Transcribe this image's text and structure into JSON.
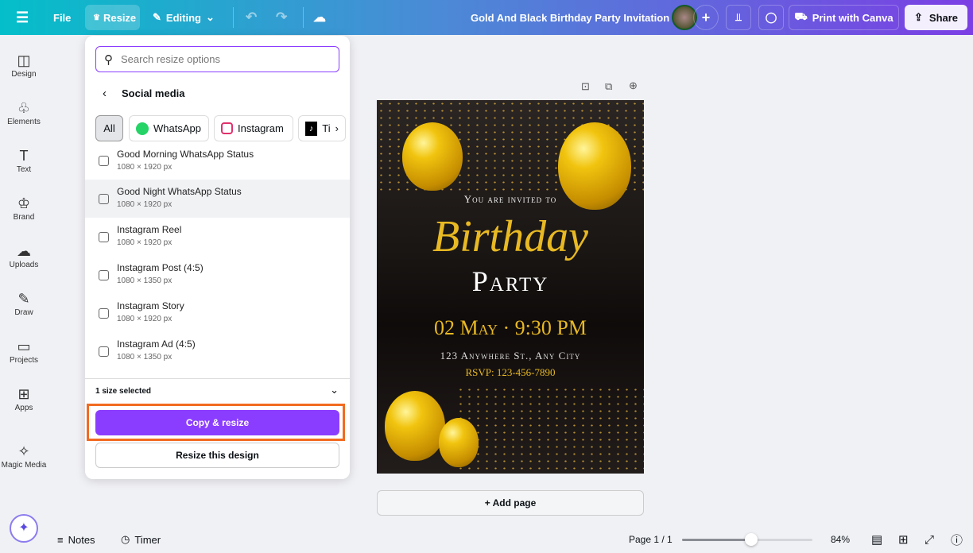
{
  "topbar": {
    "menu_icon": "hamburger-icon",
    "file": "File",
    "resize": "Resize",
    "editing": "Editing",
    "title": "Gold And Black Birthday Party Invitation",
    "print": "Print with Canva",
    "share": "Share"
  },
  "sidebar": {
    "items": [
      {
        "label": "Design",
        "icon": "◫"
      },
      {
        "label": "Elements",
        "icon": "♧"
      },
      {
        "label": "Text",
        "icon": "T"
      },
      {
        "label": "Brand",
        "icon": "♔"
      },
      {
        "label": "Uploads",
        "icon": "☁"
      },
      {
        "label": "Draw",
        "icon": "✎"
      },
      {
        "label": "Projects",
        "icon": "▭"
      },
      {
        "label": "Apps",
        "icon": "⊞"
      },
      {
        "label": "Magic Media",
        "icon": "✧"
      }
    ]
  },
  "resize_panel": {
    "search_placeholder": "Search resize options",
    "section": "Social media",
    "chips": [
      "All",
      "WhatsApp",
      "Instagram",
      "Ti"
    ],
    "items": [
      {
        "name": "Good Morning WhatsApp Status",
        "size": "1080 × 1920 px"
      },
      {
        "name": "Good Night WhatsApp Status",
        "size": "1080 × 1920 px"
      },
      {
        "name": "Instagram Reel",
        "size": "1080 × 1920 px"
      },
      {
        "name": "Instagram Post (4:5)",
        "size": "1080 × 1350 px"
      },
      {
        "name": "Instagram Story",
        "size": "1080 × 1920 px"
      },
      {
        "name": "Instagram Ad (4:5)",
        "size": "1080 × 1350 px"
      }
    ],
    "selected_count": "1 size selected",
    "copy_resize": "Copy & resize",
    "resize_this": "Resize this design"
  },
  "design": {
    "invited": "You are invited to",
    "birthday": "Birthday",
    "party": "Party",
    "date": "02 May · 9:30 PM",
    "address": "123 Anywhere St., Any City",
    "rsvp": "RSVP: 123-456-7890"
  },
  "add_page": "+ Add page",
  "footer": {
    "notes": "Notes",
    "timer": "Timer",
    "page": "Page 1 / 1",
    "zoom_percent": 53,
    "zoom": "84%"
  },
  "colors": {
    "accent": "#8b3dff",
    "highlight": "#f26b21",
    "gold": "#e8b923"
  }
}
